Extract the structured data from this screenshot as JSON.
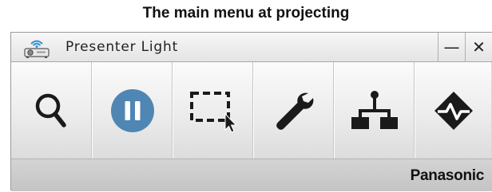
{
  "caption": "The main menu at projecting",
  "window": {
    "title": "Presenter Light",
    "minimize_label": "—",
    "close_label": "✕",
    "app_icon": "projector-wifi-icon"
  },
  "toolbar": {
    "buttons": [
      {
        "name": "search",
        "icon": "magnifier-icon"
      },
      {
        "name": "pause",
        "icon": "pause-circle-icon",
        "state": "active"
      },
      {
        "name": "area-select",
        "icon": "selection-rectangle-icon"
      },
      {
        "name": "settings",
        "icon": "wrench-icon"
      },
      {
        "name": "network",
        "icon": "network-tree-icon"
      },
      {
        "name": "more",
        "icon": "diamond-pulse-icon"
      }
    ]
  },
  "status": {
    "brand": "Panasonic"
  },
  "colors": {
    "pause_fill": "#4f86b4",
    "icon_dark": "#1a1a1a",
    "wifi_blue": "#2f8fd0"
  }
}
